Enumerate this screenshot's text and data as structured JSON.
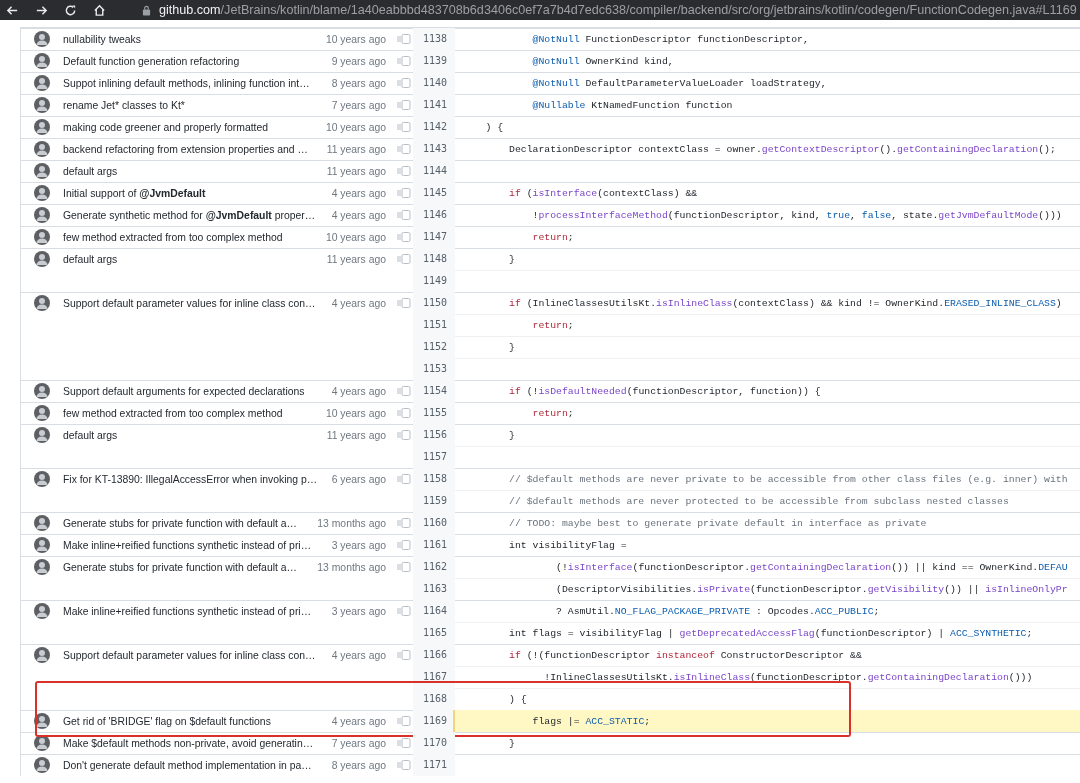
{
  "browser": {
    "url_host": "github.com",
    "url_path": "/JetBrains/kotlin/blame/1a40eabbbd483708b6d3406c0ef7a7b4d7edc638/compiler/backend/src/org/jetbrains/kotlin/codegen/FunctionCodegen.java#L1169"
  },
  "hunks": [
    {
      "message": "nullability tweaks",
      "age": "10 years ago",
      "lines": [
        {
          "number": "1138",
          "selected": false,
          "boxed": false,
          "tokens": [
            {
              "kind": "ann",
              "text": "            @NotNull"
            },
            {
              "kind": "txt",
              "text": " FunctionDescriptor functionDescriptor,"
            }
          ]
        }
      ]
    },
    {
      "message": "Default function generation refactoring",
      "age": "9 years ago",
      "lines": [
        {
          "number": "1139",
          "selected": false,
          "boxed": false,
          "tokens": [
            {
              "kind": "ann",
              "text": "            @NotNull"
            },
            {
              "kind": "txt",
              "text": " OwnerKind kind,"
            }
          ]
        }
      ]
    },
    {
      "message": "Suppot inlining default methods, inlining function int…",
      "age": "8 years ago",
      "lines": [
        {
          "number": "1140",
          "selected": false,
          "boxed": false,
          "tokens": [
            {
              "kind": "ann",
              "text": "            @NotNull"
            },
            {
              "kind": "txt",
              "text": " DefaultParameterValueLoader loadStrategy,"
            }
          ]
        }
      ]
    },
    {
      "message": "rename Jet* classes to Kt*",
      "age": "7 years ago",
      "lines": [
        {
          "number": "1141",
          "selected": false,
          "boxed": false,
          "tokens": [
            {
              "kind": "ann",
              "text": "            @Nullable"
            },
            {
              "kind": "txt",
              "text": " KtNamedFunction function"
            }
          ]
        }
      ]
    },
    {
      "message": "making code greener and properly formatted",
      "age": "10 years ago",
      "lines": [
        {
          "number": "1142",
          "selected": false,
          "boxed": false,
          "tokens": [
            {
              "kind": "txt",
              "text": "    ) {"
            }
          ]
        }
      ]
    },
    {
      "message": "backend refactoring from extension properties and …",
      "age": "11 years ago",
      "lines": [
        {
          "number": "1143",
          "selected": false,
          "boxed": false,
          "tokens": [
            {
              "kind": "txt",
              "text": "        DeclarationDescriptor contextClass = owner."
            },
            {
              "kind": "fn",
              "text": "getContextDescriptor"
            },
            {
              "kind": "txt",
              "text": "()."
            },
            {
              "kind": "fn",
              "text": "getContainingDeclaration"
            },
            {
              "kind": "txt",
              "text": "();"
            }
          ]
        }
      ]
    },
    {
      "message": "default args",
      "age": "11 years ago",
      "lines": [
        {
          "number": "1144",
          "selected": false,
          "boxed": false
        }
      ]
    },
    {
      "message": "Initial support of **@JvmDefault**",
      "age": "4 years ago",
      "lines": [
        {
          "number": "1145",
          "selected": false,
          "boxed": false,
          "tokens": [
            {
              "kind": "kw",
              "text": "        if"
            },
            {
              "kind": "txt",
              "text": " ("
            },
            {
              "kind": "fn",
              "text": "isInterface"
            },
            {
              "kind": "txt",
              "text": "(contextClass) &&"
            }
          ]
        }
      ]
    },
    {
      "message": "Generate synthetic method for **@JvmDefault** proper…",
      "age": "4 years ago",
      "lines": [
        {
          "number": "1146",
          "selected": false,
          "boxed": false,
          "tokens": [
            {
              "kind": "txt",
              "text": "            !"
            },
            {
              "kind": "fn",
              "text": "processInterfaceMethod"
            },
            {
              "kind": "txt",
              "text": "(functionDescriptor, kind, "
            },
            {
              "kind": "const",
              "text": "true"
            },
            {
              "kind": "txt",
              "text": ", "
            },
            {
              "kind": "const",
              "text": "false"
            },
            {
              "kind": "txt",
              "text": ", state."
            },
            {
              "kind": "fn",
              "text": "getJvmDefaultMode"
            },
            {
              "kind": "txt",
              "text": "()))"
            }
          ]
        }
      ]
    },
    {
      "message": "few method extracted from too complex method",
      "age": "10 years ago",
      "lines": [
        {
          "number": "1147",
          "selected": false,
          "boxed": false,
          "tokens": [
            {
              "kind": "kw",
              "text": "            return"
            },
            {
              "kind": "txt",
              "text": ";"
            }
          ]
        }
      ]
    },
    {
      "message": "default args",
      "age": "11 years ago",
      "lines": [
        {
          "number": "1148",
          "selected": false,
          "boxed": false,
          "tokens": [
            {
              "kind": "txt",
              "text": "        }"
            }
          ]
        },
        {
          "number": "1149",
          "selected": false,
          "boxed": false
        }
      ]
    },
    {
      "message": "Support default parameter values for inline class con…",
      "age": "4 years ago",
      "lines": [
        {
          "number": "1150",
          "selected": false,
          "boxed": false,
          "tokens": [
            {
              "kind": "kw",
              "text": "        if"
            },
            {
              "kind": "txt",
              "text": " (InlineClassesUtilsKt."
            },
            {
              "kind": "fn",
              "text": "isInlineClass"
            },
            {
              "kind": "txt",
              "text": "(contextClass) && kind != OwnerKind."
            },
            {
              "kind": "const",
              "text": "ERASED_INLINE_CLASS"
            },
            {
              "kind": "txt",
              "text": ")"
            }
          ]
        },
        {
          "number": "1151",
          "selected": false,
          "boxed": false,
          "tokens": [
            {
              "kind": "kw",
              "text": "            return"
            },
            {
              "kind": "txt",
              "text": ";"
            }
          ]
        },
        {
          "number": "1152",
          "selected": false,
          "boxed": false,
          "tokens": [
            {
              "kind": "txt",
              "text": "        }"
            }
          ]
        },
        {
          "number": "1153",
          "selected": false,
          "boxed": false
        }
      ]
    },
    {
      "message": "Support default arguments for expected declarations",
      "age": "4 years ago",
      "lines": [
        {
          "number": "1154",
          "selected": false,
          "boxed": false,
          "tokens": [
            {
              "kind": "kw",
              "text": "        if"
            },
            {
              "kind": "txt",
              "text": " (!"
            },
            {
              "kind": "fn",
              "text": "isDefaultNeeded"
            },
            {
              "kind": "txt",
              "text": "(functionDescriptor, function)) {"
            }
          ]
        }
      ]
    },
    {
      "message": "few method extracted from too complex method",
      "age": "10 years ago",
      "lines": [
        {
          "number": "1155",
          "selected": false,
          "boxed": false,
          "tokens": [
            {
              "kind": "kw",
              "text": "            return"
            },
            {
              "kind": "txt",
              "text": ";"
            }
          ]
        }
      ]
    },
    {
      "message": "default args",
      "age": "11 years ago",
      "lines": [
        {
          "number": "1156",
          "selected": false,
          "boxed": false,
          "tokens": [
            {
              "kind": "txt",
              "text": "        }"
            }
          ]
        },
        {
          "number": "1157",
          "selected": false,
          "boxed": false
        }
      ]
    },
    {
      "message": "Fix for KT-13890: IllegalAccessError when invoking p…",
      "age": "6 years ago",
      "lines": [
        {
          "number": "1158",
          "selected": false,
          "boxed": false,
          "tokens": [
            {
              "kind": "cmt",
              "text": "        // $default methods are never private to be accessible from other class files (e.g. inner) with"
            }
          ]
        },
        {
          "number": "1159",
          "selected": false,
          "boxed": false,
          "tokens": [
            {
              "kind": "cmt",
              "text": "        // $default methods are never protected to be accessible from subclass nested classes"
            }
          ]
        }
      ]
    },
    {
      "message": "Generate stubs for private function with default a…",
      "age": "13 months ago",
      "lines": [
        {
          "number": "1160",
          "selected": false,
          "boxed": false,
          "tokens": [
            {
              "kind": "cmt",
              "text": "        // TODO: maybe best to generate private default in interface as private"
            }
          ]
        }
      ]
    },
    {
      "message": "Make inline+reified functions synthetic instead of pri…",
      "age": "3 years ago",
      "lines": [
        {
          "number": "1161",
          "selected": false,
          "boxed": false,
          "tokens": [
            {
              "kind": "txt",
              "text": "        int visibilityFlag ="
            }
          ]
        }
      ]
    },
    {
      "message": "Generate stubs for private function with default a…",
      "age": "13 months ago",
      "lines": [
        {
          "number": "1162",
          "selected": false,
          "boxed": false,
          "tokens": [
            {
              "kind": "txt",
              "text": "                (!"
            },
            {
              "kind": "fn",
              "text": "isInterface"
            },
            {
              "kind": "txt",
              "text": "(functionDescriptor."
            },
            {
              "kind": "fn",
              "text": "getContainingDeclaration"
            },
            {
              "kind": "txt",
              "text": "()) || kind == OwnerKind."
            },
            {
              "kind": "const",
              "text": "DEFAU"
            }
          ]
        },
        {
          "number": "1163",
          "selected": false,
          "boxed": false,
          "tokens": [
            {
              "kind": "txt",
              "text": "                (DescriptorVisibilities."
            },
            {
              "kind": "fn",
              "text": "isPrivate"
            },
            {
              "kind": "txt",
              "text": "(functionDescriptor."
            },
            {
              "kind": "fn",
              "text": "getVisibility"
            },
            {
              "kind": "txt",
              "text": "()) || "
            },
            {
              "kind": "fn",
              "text": "isInlineOnlyPr"
            }
          ]
        }
      ]
    },
    {
      "message": "Make inline+reified functions synthetic instead of pri…",
      "age": "3 years ago",
      "lines": [
        {
          "number": "1164",
          "selected": false,
          "boxed": false,
          "tokens": [
            {
              "kind": "txt",
              "text": "                ? AsmUtil."
            },
            {
              "kind": "const",
              "text": "NO_FLAG_PACKAGE_PRIVATE"
            },
            {
              "kind": "txt",
              "text": " : Opcodes."
            },
            {
              "kind": "const",
              "text": "ACC_PUBLIC"
            },
            {
              "kind": "txt",
              "text": ";"
            }
          ]
        },
        {
          "number": "1165",
          "selected": false,
          "boxed": false,
          "tokens": [
            {
              "kind": "txt",
              "text": "        int flags = visibilityFlag | "
            },
            {
              "kind": "fn",
              "text": "getDeprecatedAccessFlag"
            },
            {
              "kind": "txt",
              "text": "(functionDescriptor) | "
            },
            {
              "kind": "const",
              "text": "ACC_SYNTHETIC"
            },
            {
              "kind": "txt",
              "text": ";"
            }
          ]
        }
      ]
    },
    {
      "message": "Support default parameter values for inline class con…",
      "age": "4 years ago",
      "lines": [
        {
          "number": "1166",
          "selected": false,
          "boxed": false,
          "tokens": [
            {
              "kind": "kw",
              "text": "        if"
            },
            {
              "kind": "txt",
              "text": " (!(functionDescriptor "
            },
            {
              "kind": "kw",
              "text": "instanceof"
            },
            {
              "kind": "txt",
              "text": " ConstructorDescriptor &&"
            }
          ]
        },
        {
          "number": "1167",
          "selected": false,
          "boxed": false,
          "tokens": [
            {
              "kind": "txt",
              "text": "              !InlineClassesUtilsKt."
            },
            {
              "kind": "fn",
              "text": "isInlineClass"
            },
            {
              "kind": "txt",
              "text": "(functionDescriptor."
            },
            {
              "kind": "fn",
              "text": "getContainingDeclaration"
            },
            {
              "kind": "txt",
              "text": "()))"
            }
          ]
        },
        {
          "number": "1168",
          "selected": false,
          "boxed": true,
          "tokens": [
            {
              "kind": "txt",
              "text": "        ) {"
            }
          ]
        }
      ]
    },
    {
      "message": "Get rid of 'BRIDGE' flag on $default functions",
      "age": "4 years ago",
      "lines": [
        {
          "number": "1169",
          "selected": true,
          "boxed": true,
          "tokens": [
            {
              "kind": "txt",
              "text": "            flags |= "
            },
            {
              "kind": "const",
              "text": "ACC_STATIC"
            },
            {
              "kind": "txt",
              "text": ";"
            }
          ]
        }
      ]
    },
    {
      "message": "Make $default methods non-private, avoid generatin…",
      "age": "7 years ago",
      "lines": [
        {
          "number": "1170",
          "selected": false,
          "boxed": false,
          "tokens": [
            {
              "kind": "txt",
              "text": "        }"
            }
          ]
        }
      ]
    },
    {
      "message": "Don't generate default method implementation in pa…",
      "age": "8 years ago",
      "lines": [
        {
          "number": "1171",
          "selected": false,
          "boxed": false
        }
      ]
    }
  ]
}
